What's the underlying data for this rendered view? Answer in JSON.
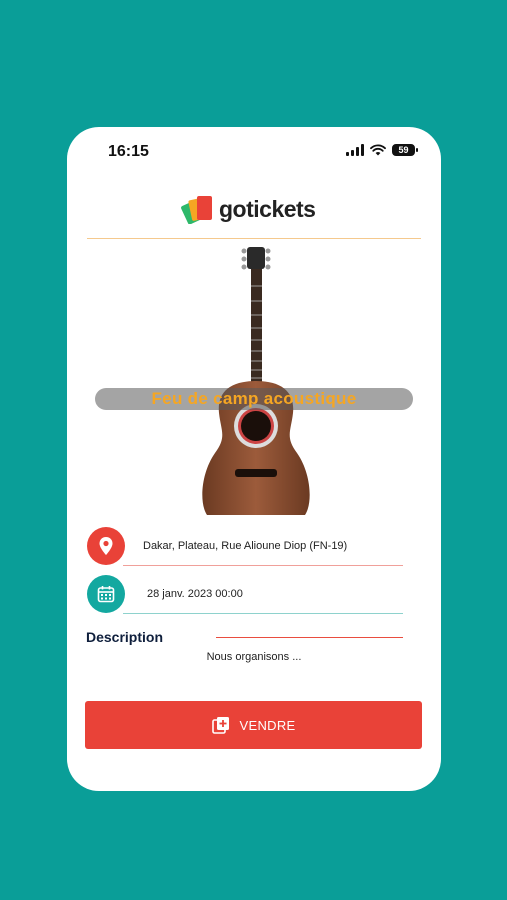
{
  "status_bar": {
    "time": "16:15",
    "battery": "59"
  },
  "header": {
    "logo_text": "gotickets"
  },
  "event": {
    "title": "Feu de camp acoustique",
    "location": "Dakar, Plateau, Rue Alioune Diop (FN-19)",
    "datetime": "28 janv. 2023 00:00"
  },
  "description": {
    "label": "Description",
    "text": "Nous organisons ..."
  },
  "actions": {
    "sell_label": "VENDRE"
  },
  "colors": {
    "background": "#0a9e98",
    "accent_red": "#e94238",
    "accent_teal": "#13a8a0",
    "title_orange": "#f5a623"
  }
}
